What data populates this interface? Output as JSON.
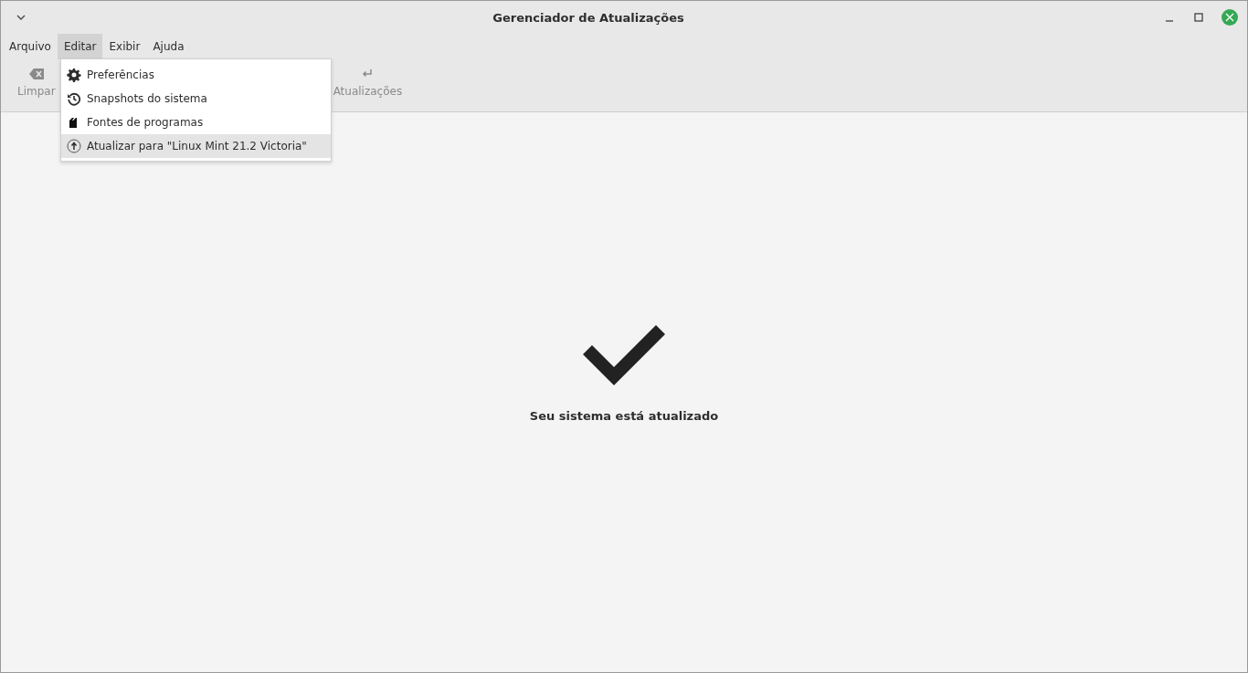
{
  "window": {
    "title": "Gerenciador de Atualizações"
  },
  "menubar": [
    {
      "label": "Arquivo",
      "selected": false
    },
    {
      "label": "Editar",
      "selected": true
    },
    {
      "label": "Exibir",
      "selected": false
    },
    {
      "label": "Ajuda",
      "selected": false
    }
  ],
  "toolbar": [
    {
      "kind": "clear",
      "label": "Limpar"
    },
    {
      "kind": "refresh",
      "label": "Atualizações"
    }
  ],
  "menu": {
    "items": [
      {
        "kind": "gear",
        "label": "Preferências",
        "selected": false
      },
      {
        "kind": "history",
        "label": "Snapshots do sistema",
        "selected": false
      },
      {
        "kind": "package",
        "label": "Fontes de programas",
        "selected": false
      },
      {
        "kind": "upgrade",
        "label": "Atualizar para \"Linux Mint 21.2 Victoria\"",
        "selected": true
      }
    ]
  },
  "status": {
    "message": "Seu sistema está atualizado"
  }
}
